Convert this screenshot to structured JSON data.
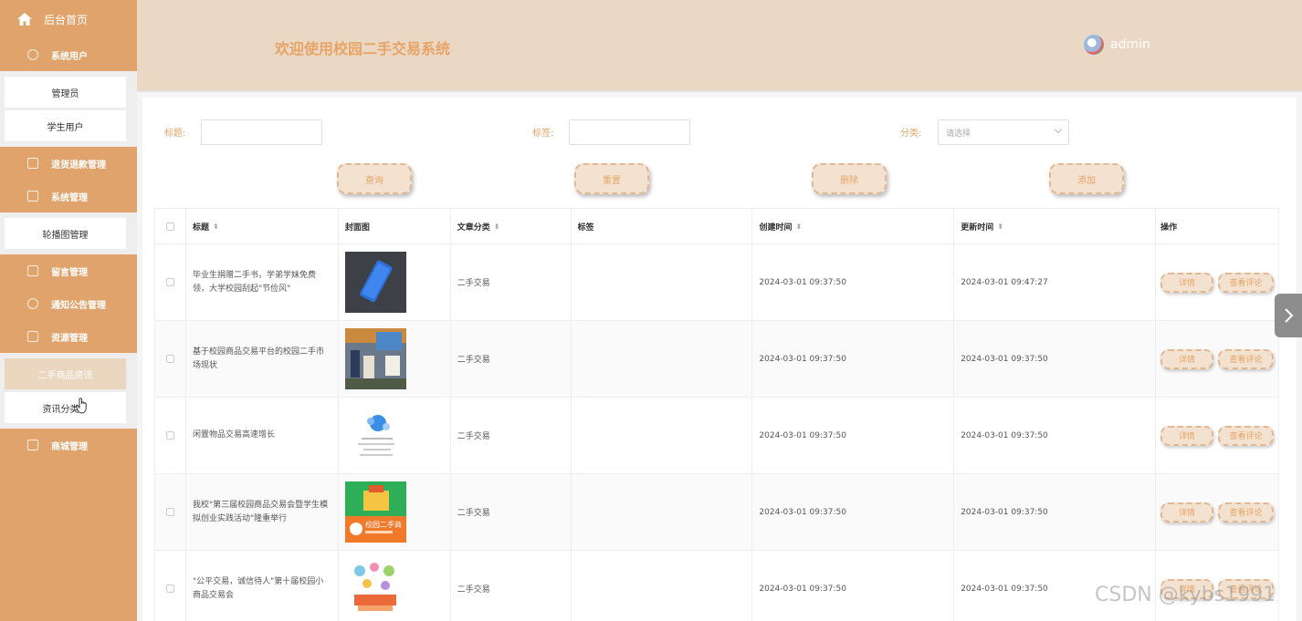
{
  "sidebar": {
    "home": "后台首页",
    "system_users": "系统用户",
    "admin_item": "管理员",
    "student_item": "学生用户",
    "refund_group": "退货退款管理",
    "system_group": "系统管理",
    "carousel_item": "轮播图管理",
    "message_group": "留言管理",
    "notice_group": "通知公告管理",
    "resource_group": "资源管理",
    "goods_news_item": "二手商品资讯",
    "news_category_item": "资讯分类",
    "mall_group": "商城管理"
  },
  "header": {
    "title": "欢迎使用校园二手交易系统",
    "username": "admin"
  },
  "search": {
    "title_label": "标题:",
    "tag_label": "标签:",
    "category_label": "分类:",
    "category_placeholder": "请选择"
  },
  "buttons": {
    "query": "查询",
    "reset": "重置",
    "delete": "删除",
    "add": "添加"
  },
  "table": {
    "headers": {
      "title": "标题",
      "cover": "封面图",
      "category": "文章分类",
      "tag": "标签",
      "created": "创建时间",
      "updated": "更新时间",
      "actions": "操作"
    },
    "rows": [
      {
        "title": "毕业生捐赠二手书，学弟学妹免费领，大学校园刮起\"节俭风\"",
        "category": "二手交易",
        "tag": "",
        "created": "2024-03-01 09:37:50",
        "updated": "2024-03-01 09:47:27"
      },
      {
        "title": "基于校园商品交易平台的校园二手市场现状",
        "category": "二手交易",
        "tag": "",
        "created": "2024-03-01 09:37:50",
        "updated": "2024-03-01 09:37:50"
      },
      {
        "title": "闲置物品交易高速增长",
        "category": "二手交易",
        "tag": "",
        "created": "2024-03-01 09:37:50",
        "updated": "2024-03-01 09:37:50"
      },
      {
        "title": "我校\"第三届校园商品交易会暨学生模拟创业实践活动\"隆重举行",
        "category": "二手交易",
        "tag": "",
        "created": "2024-03-01 09:37:50",
        "updated": "2024-03-01 09:37:50"
      },
      {
        "title": "\"公平交易，诚信待人\"第十届校园小商品交易会",
        "category": "二手交易",
        "tag": "",
        "created": "2024-03-01 09:37:50",
        "updated": "2024-03-01 09:37:50"
      }
    ],
    "action_detail": "详情",
    "action_comments": "查看评论"
  },
  "thumb4_text": "校园二手商",
  "watermark": "CSDN @kybs1991"
}
